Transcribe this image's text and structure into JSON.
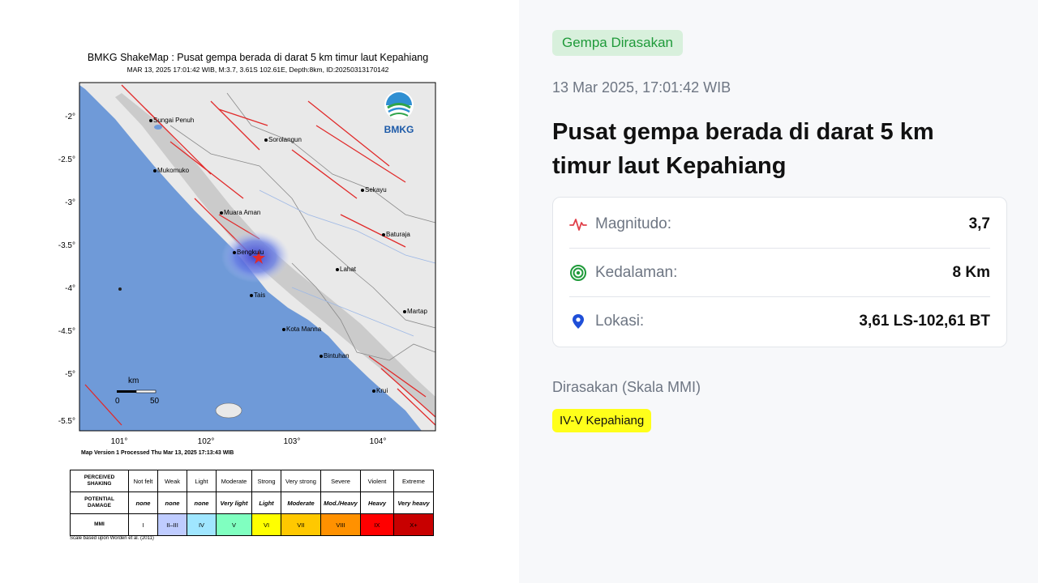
{
  "shakemap": {
    "title": "BMKG ShakeMap : Pusat gempa berada di darat 5 km timur laut Kepahiang",
    "subtitle": "MAR 13, 2025 17:01:42 WIB, M:3.7, 3.61S 102.61E, Depth:8km, ID:20250313170142",
    "logo_text": "BMKG",
    "lat_ticks": [
      "-2°",
      "-2.5°",
      "-3°",
      "-3.5°",
      "-4°",
      "-4.5°",
      "-5°",
      "-5.5°"
    ],
    "lon_ticks": [
      "101°",
      "102°",
      "103°",
      "104°"
    ],
    "cities": [
      "Sungai Penuh",
      "Sorolangun",
      "Mukomuko",
      "Sekayu",
      "Muara Aman",
      "Baturaja",
      "Bengkulu",
      "Lahat",
      "Tais",
      "Martap",
      "Kota Manna",
      "Bintuhan",
      "Krui"
    ],
    "scale_bar": {
      "unit": "km",
      "start": "0",
      "end": "50"
    },
    "version_note": "Map Version 1 Processed Thu Mar 13, 2025 17:13:43 WIB",
    "scale_note": "Scale based upon Worden et al. (2011)",
    "colors": {
      "land": "#e9e9e9",
      "sea": "#6f9ad8",
      "fault": "#e12a2a"
    },
    "legend": {
      "row_headers": [
        "PERCEIVED SHAKING",
        "POTENTIAL DAMAGE",
        "MMI"
      ],
      "shaking": [
        "Not felt",
        "Weak",
        "Light",
        "Moderate",
        "Strong",
        "Very strong",
        "Severe",
        "Violent",
        "Extreme"
      ],
      "damage": [
        "none",
        "none",
        "none",
        "Very light",
        "Light",
        "Moderate",
        "Mod./Heavy",
        "Heavy",
        "Very heavy"
      ],
      "mmi": [
        "I",
        "II–III",
        "IV",
        "V",
        "VI",
        "VII",
        "VIII",
        "IX",
        "X+"
      ],
      "mmi_colors": [
        "#ffffff",
        "#bfccff",
        "#a0e6ff",
        "#80ffc0",
        "#ffff00",
        "#ffc800",
        "#ff9100",
        "#ff0000",
        "#c80000"
      ]
    }
  },
  "detail": {
    "badge": "Gempa Dirasakan",
    "datetime": "13 Mar 2025, 17:01:42 WIB",
    "headline": "Pusat gempa berada di darat 5 km timur laut Kepahiang",
    "info": {
      "magnitude": {
        "label": "Magnitudo:",
        "value": "3,7",
        "icon": "pulse-icon",
        "color": "#e0404a"
      },
      "depth": {
        "label": "Kedalaman:",
        "value": "8 Km",
        "icon": "target-icon",
        "color": "#1f9a3a"
      },
      "location": {
        "label": "Lokasi:",
        "value": "3,61 LS-102,61 BT",
        "icon": "map-pin-icon",
        "color": "#1f4fd8"
      }
    },
    "felt_label": "Dirasakan (Skala MMI)",
    "felt": [
      "IV-V Kepahiang"
    ]
  }
}
